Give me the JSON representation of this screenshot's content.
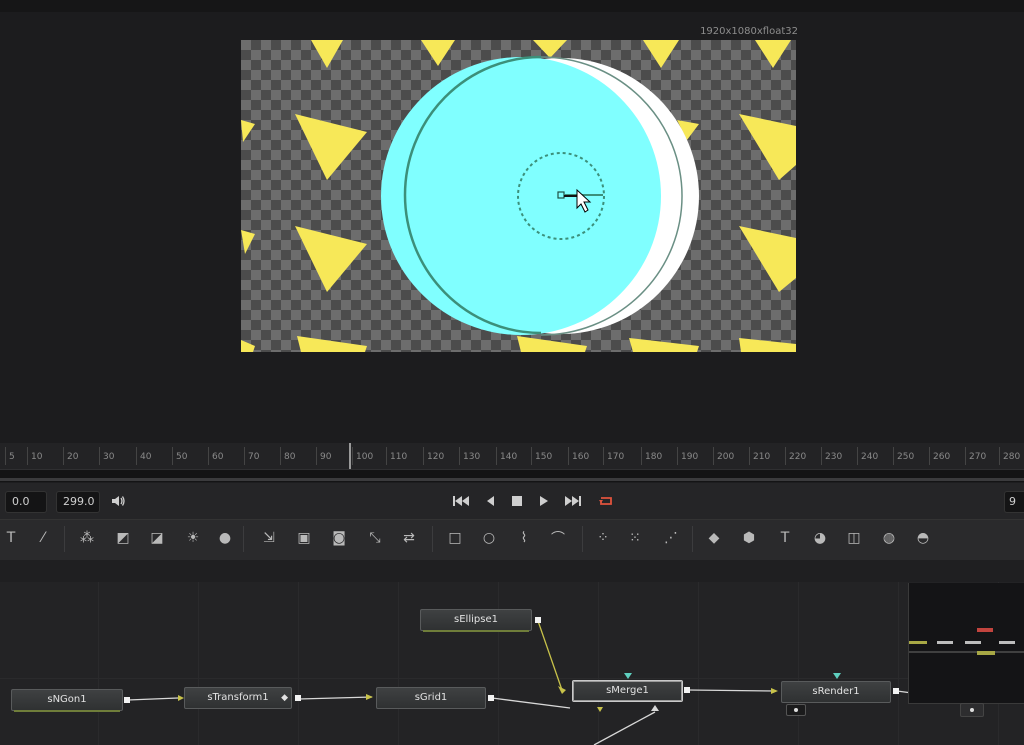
{
  "viewer": {
    "resolution_label": "1920x1080xfloat32"
  },
  "ruler": {
    "ticks": [
      "5",
      "10",
      "20",
      "30",
      "40",
      "50",
      "60",
      "70",
      "80",
      "90",
      "100",
      "110",
      "120",
      "130",
      "140",
      "150",
      "160",
      "170",
      "180",
      "190",
      "200",
      "210",
      "220",
      "230",
      "240",
      "250",
      "260",
      "270",
      "280"
    ]
  },
  "transport": {
    "start_frame": "0.0",
    "end_frame": "299.0",
    "current_frame_partial": "9",
    "buttons": [
      "skip-to-start-icon",
      "step-back-icon",
      "stop-icon",
      "play-icon",
      "skip-to-end-icon",
      "loop-icon"
    ]
  },
  "toolbar": {
    "tools": [
      {
        "name": "text-tool-icon",
        "glyph": "T"
      },
      {
        "name": "paint-brush-icon",
        "glyph": "⁄"
      },
      {
        "name": "particles-icon",
        "glyph": "⁂"
      },
      {
        "name": "color-corrector-icon",
        "glyph": "◩"
      },
      {
        "name": "curves-icon",
        "glyph": "◪"
      },
      {
        "name": "brightness-icon",
        "glyph": "☀"
      },
      {
        "name": "blur-icon",
        "glyph": "●"
      },
      {
        "name": "loader-icon",
        "glyph": "⇲"
      },
      {
        "name": "merge-icon",
        "glyph": "▣"
      },
      {
        "name": "matte-control-icon",
        "glyph": "◙"
      },
      {
        "name": "resize-icon",
        "glyph": "⤡"
      },
      {
        "name": "saver-icon",
        "glyph": "⇄"
      },
      {
        "name": "rectangle-mask-icon",
        "glyph": "□"
      },
      {
        "name": "ellipse-mask-icon",
        "glyph": "○"
      },
      {
        "name": "polygon-mask-icon",
        "glyph": "⌇"
      },
      {
        "name": "bspline-mask-icon",
        "glyph": "⌒"
      },
      {
        "name": "particle-emitter-icon",
        "glyph": "⁘"
      },
      {
        "name": "particle-render-icon",
        "glyph": "⁙"
      },
      {
        "name": "pixel-particles-icon",
        "glyph": "⋰"
      },
      {
        "name": "shape-3d-icon",
        "glyph": "◆"
      },
      {
        "name": "merge-3d-icon",
        "glyph": "⬢"
      },
      {
        "name": "text-3d-icon",
        "glyph": "T"
      },
      {
        "name": "render-3d-icon",
        "glyph": "◕"
      },
      {
        "name": "camera-3d-icon",
        "glyph": "◫"
      },
      {
        "name": "light-3d-icon",
        "glyph": "◍"
      },
      {
        "name": "image-plane-3d-icon",
        "glyph": "◓"
      }
    ]
  },
  "nodes": {
    "sEllipse1": "sEllipse1",
    "sNGon1": "sNGon1",
    "sTransform1": "sTransform1",
    "sGrid1": "sGrid1",
    "sMerge1": "sMerge1",
    "sRender1": "sRender1"
  },
  "colors": {
    "triangle": "#f7e858",
    "ellipse_cyan": "#80ffff",
    "ellipse_white": "#ffffff",
    "checker_dark": "#4c4c4c",
    "checker_light": "#6d6d6d",
    "loop_icon": "#e0533d"
  }
}
